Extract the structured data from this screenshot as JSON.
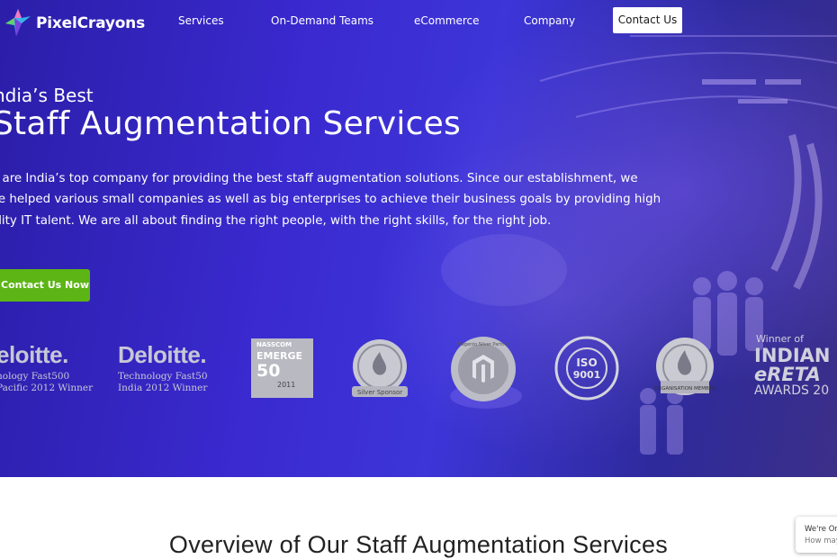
{
  "brand": {
    "name": "PixelCrayons"
  },
  "nav": {
    "items": [
      "Services",
      "On-Demand Teams",
      "eCommerce",
      "Company"
    ],
    "contact_label": "Contact Us"
  },
  "hero": {
    "eyebrow": "ndia’s Best",
    "headline": "Staff Augmentation Services",
    "paragraph_lines": [
      "e are India’s top company for providing the best staff augmentation solutions. Since our establishment, we",
      "ve helped various small companies as well as big enterprises to achieve their business goals by providing high",
      "ality IT talent. We are all about finding the right people, with the right skills, for the right job."
    ],
    "cta_label": "Contact Us Now"
  },
  "awards": {
    "deloitte_1": {
      "title": "eloitte.",
      "line1": "nology Fast500",
      "line2": "Pacific 2012 Winner"
    },
    "deloitte_2": {
      "title": "Deloitte.",
      "line1": "Technology Fast50",
      "line2": "India 2012 Winner"
    },
    "nasscom": {
      "line1": "NASSCOM",
      "line2": "EMERGE",
      "line3": "50",
      "line4": "2011"
    },
    "drupalcon": {
      "label": "Silver Sponsor"
    },
    "magento": {
      "label": "Magento Silver Partner"
    },
    "iso": {
      "line1": "ISO",
      "line2": "9001"
    },
    "drupal_assoc": {
      "label": "ORGANISATION MEMBER"
    },
    "eretail": {
      "line1": "Winner of",
      "line2": "INDIAN",
      "line3": "eRETA",
      "line4": "AWARDS 20"
    }
  },
  "overview": {
    "title": "Overview of Our Staff Augmentation Services"
  },
  "chat": {
    "line1": "We're On",
    "line2": "How may"
  },
  "colors": {
    "hero_bg": "#3a2ad0",
    "cta_green": "#5cb515",
    "text_white": "#ffffff"
  }
}
